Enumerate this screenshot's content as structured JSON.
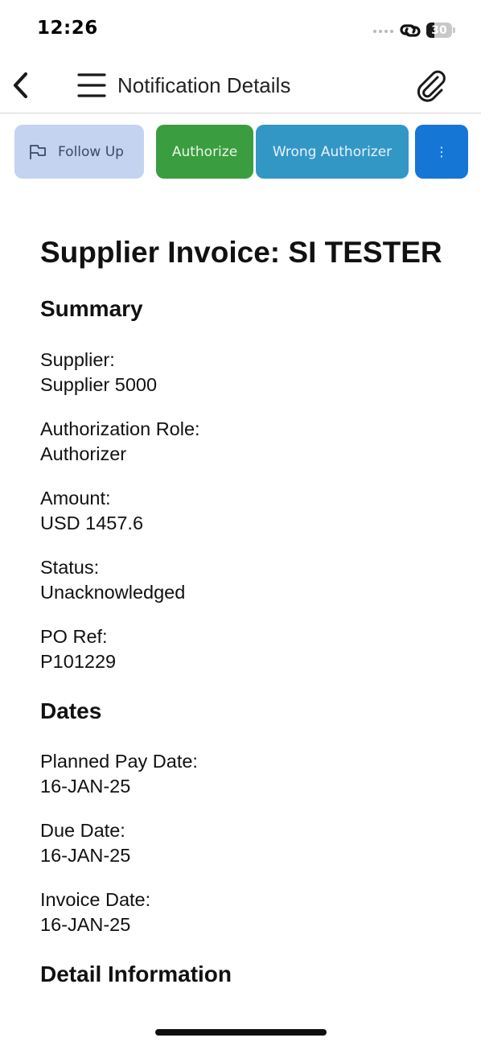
{
  "status_bar": {
    "time": "12:26",
    "battery_text": "30",
    "battery_level": 0.3
  },
  "header": {
    "title": "Notification Details"
  },
  "actions": {
    "follow_up": "Follow Up",
    "authorize": "Authorize",
    "wrong_authorizer": "Wrong Authorizer",
    "more": "⋮"
  },
  "colors": {
    "follow_up_bg": "#c3d3f0",
    "authorize_bg": "#3a9d3f",
    "wrong_authorizer_bg": "#3397c6",
    "more_bg": "#1576d6"
  },
  "document": {
    "title": "Supplier Invoice: SI TESTER",
    "summary": {
      "heading": "Summary",
      "fields": [
        {
          "label": "Supplier:",
          "value": "Supplier 5000"
        },
        {
          "label": "Authorization Role:",
          "value": "Authorizer"
        },
        {
          "label": "Amount:",
          "value": "USD 1457.6"
        },
        {
          "label": "Status:",
          "value": "Unacknowledged"
        },
        {
          "label": "PO Ref:",
          "value": "P101229"
        }
      ]
    },
    "dates": {
      "heading": "Dates",
      "fields": [
        {
          "label": "Planned Pay Date:",
          "value": "16-JAN-25"
        },
        {
          "label": "Due Date:",
          "value": "16-JAN-25"
        },
        {
          "label": "Invoice Date:",
          "value": "16-JAN-25"
        }
      ]
    },
    "detail": {
      "heading": "Detail Information"
    }
  },
  "icons": {
    "back": "chevron-left-icon",
    "menu": "hamburger-menu-icon",
    "attach": "paperclip-icon",
    "flag": "flag-icon"
  }
}
